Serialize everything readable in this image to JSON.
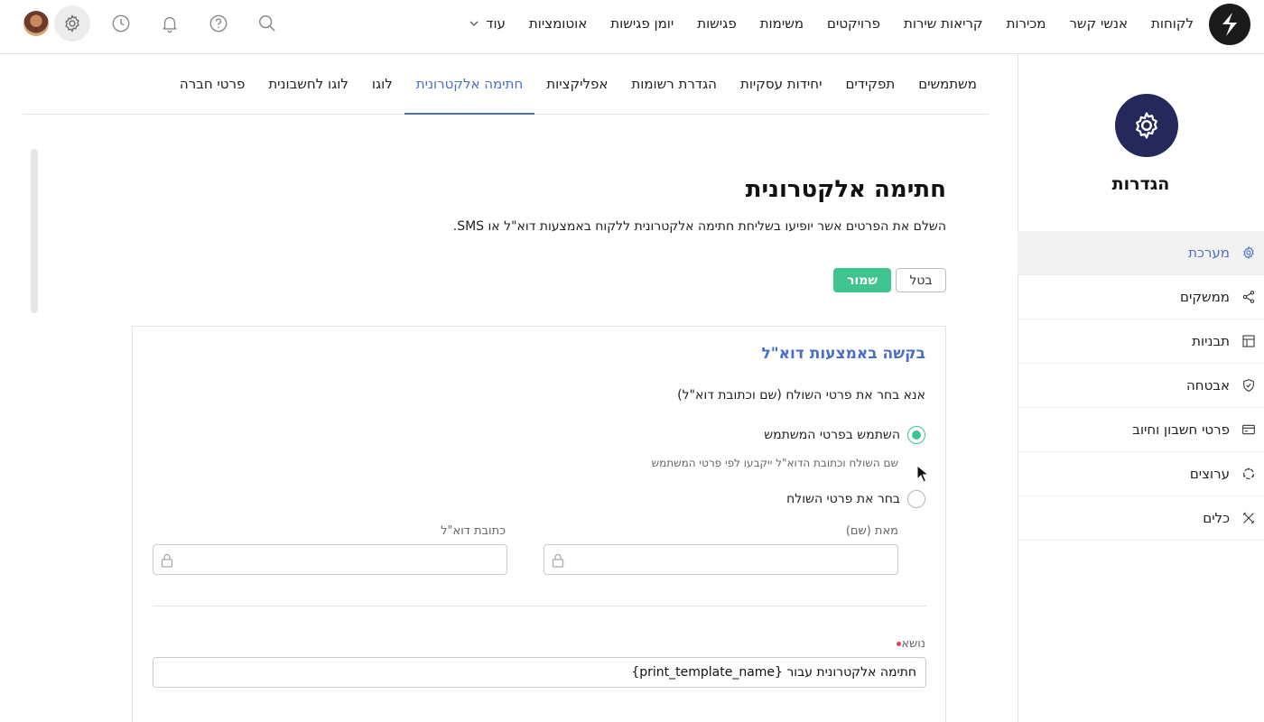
{
  "topbar": {
    "nav": [
      "לקוחות",
      "אנשי קשר",
      "מכירות",
      "קריאות שירות",
      "פרויקטים",
      "משימות",
      "פגישות",
      "יומן פגישות",
      "אוטומציות"
    ],
    "more_label": "עוד",
    "icons": [
      "search-icon",
      "help-icon",
      "bell-icon",
      "clock-icon",
      "gear-icon",
      "avatar"
    ]
  },
  "sidebar": {
    "title": "הגדרות",
    "items": [
      {
        "label": "מערכת",
        "icon": "gear-icon",
        "active": true
      },
      {
        "label": "ממשקים",
        "icon": "share-icon"
      },
      {
        "label": "תבניות",
        "icon": "layout-icon"
      },
      {
        "label": "אבטחה",
        "icon": "shield-icon"
      },
      {
        "label": "פרטי חשבון וחיוב",
        "icon": "credit-card-icon"
      },
      {
        "label": "ערוצים",
        "icon": "channels-icon"
      },
      {
        "label": "כלים",
        "icon": "tools-icon"
      }
    ]
  },
  "tabs": [
    {
      "label": "משתמשים"
    },
    {
      "label": "תפקידים"
    },
    {
      "label": "יחידות עסקיות"
    },
    {
      "label": "הגדרת רשומות"
    },
    {
      "label": "אפליקציות"
    },
    {
      "label": "חתימה אלקטרונית",
      "active": true
    },
    {
      "label": "לוגו"
    },
    {
      "label": "לוגו לחשבונית"
    },
    {
      "label": "פרטי חברה"
    }
  ],
  "page": {
    "title": "חתימה אלקטרונית",
    "description": "השלם את הפרטים אשר יופיעו בשליחת חתימה אלקטרונית ללקוח באמצעות דוא\"ל או SMS.",
    "cancel_label": "בטל",
    "save_label": "שמור"
  },
  "card": {
    "title": "בקשה באמצעות דוא\"ל",
    "subtitle": "אנא בחר את פרטי השולח (שם וכתובת דוא\"ל)",
    "option_user": "השתמש בפרטי המשתמש",
    "option_user_help": "שם השולח וכתובת הדוא\"ל ייקבעו לפי פרטי המשתמש",
    "option_sender": "בחר את פרטי השולח",
    "from_name_label": "מאת (שם)",
    "email_label": "כתובת דוא\"ל",
    "subject_label": "נושא",
    "subject_value": "חתימה אלקטרונית עבור {print_template_name}"
  },
  "colors": {
    "accent": "#4a6fc9",
    "save": "#3ec48f",
    "badge": "#25285a"
  }
}
